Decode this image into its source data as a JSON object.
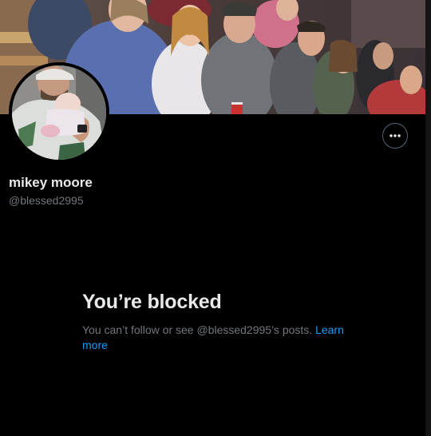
{
  "profile": {
    "display_name": "mikey moore",
    "handle": "@blessed2995",
    "banner_icon": "crowd-photo",
    "avatar_icon": "father-holding-baby-photo",
    "more_icon": "more-options-icon"
  },
  "blocked": {
    "title": "You’re blocked",
    "message": "You can’t follow or see @blessed2995’s posts.",
    "link_label": "Learn more"
  },
  "colors": {
    "background": "#000000",
    "primary_text": "#e7e9ea",
    "secondary_text": "#71767b",
    "link": "#1d9bf0",
    "button_border": "#536471"
  }
}
